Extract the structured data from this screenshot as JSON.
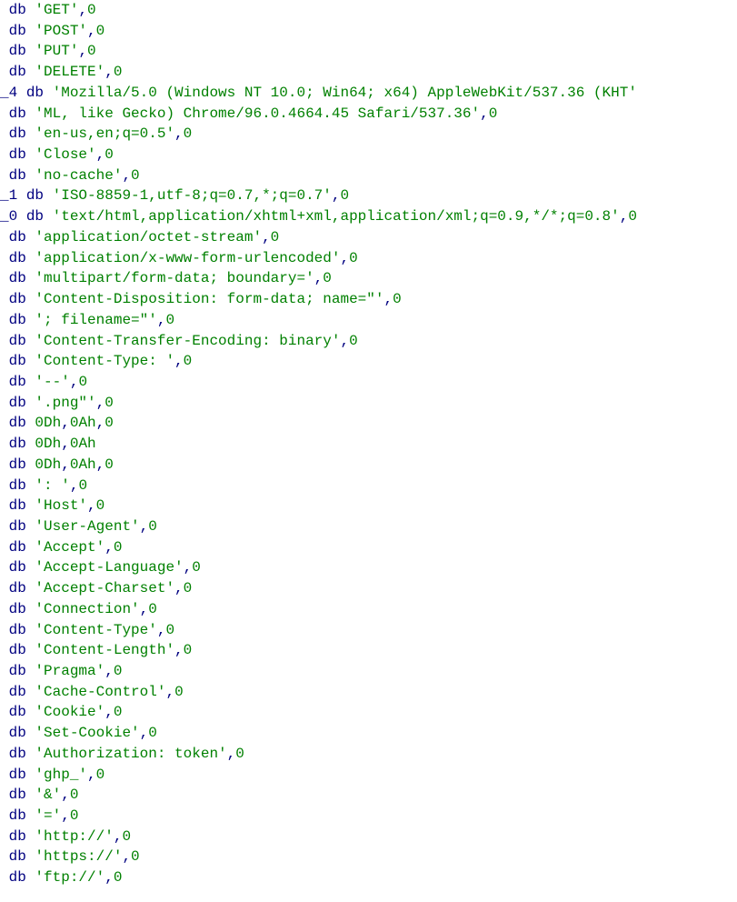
{
  "lines": [
    {
      "label": "",
      "opcode": "db",
      "string": "'GET'",
      "suffix": ",0"
    },
    {
      "label": "",
      "opcode": "db",
      "string": "'POST'",
      "suffix": ",0"
    },
    {
      "label": "",
      "opcode": "db",
      "string": "'PUT'",
      "suffix": ",0"
    },
    {
      "label": "",
      "opcode": "db",
      "string": "'DELETE'",
      "suffix": ",0"
    },
    {
      "label": "_4",
      "opcode": "db",
      "string": "'Mozilla/5.0 (Windows NT 10.0; Win64; x64) AppleWebKit/537.36 (KHT'",
      "suffix": ""
    },
    {
      "label": "",
      "opcode": "db",
      "string": "'ML, like Gecko) Chrome/96.0.4664.45 Safari/537.36'",
      "suffix": ",0"
    },
    {
      "label": "",
      "opcode": "db",
      "string": "'en-us,en;q=0.5'",
      "suffix": ",0"
    },
    {
      "label": "",
      "opcode": "db",
      "string": "'Close'",
      "suffix": ",0"
    },
    {
      "label": "",
      "opcode": "db",
      "string": "'no-cache'",
      "suffix": ",0"
    },
    {
      "label": "_1",
      "opcode": "db",
      "string": "'ISO-8859-1,utf-8;q=0.7,*;q=0.7'",
      "suffix": ",0"
    },
    {
      "label": "_0",
      "opcode": "db",
      "string": "'text/html,application/xhtml+xml,application/xml;q=0.9,*/*;q=0.8'",
      "suffix": ",0"
    },
    {
      "label": "",
      "opcode": "db",
      "string": "'application/octet-stream'",
      "suffix": ",0"
    },
    {
      "label": "",
      "opcode": "db",
      "string": "'application/x-www-form-urlencoded'",
      "suffix": ",0"
    },
    {
      "label": "",
      "opcode": "db",
      "string": "'multipart/form-data; boundary='",
      "suffix": ",0"
    },
    {
      "label": "",
      "opcode": "db",
      "string": "'Content-Disposition: form-data; name=\"'",
      "suffix": ",0"
    },
    {
      "label": "",
      "opcode": "db",
      "string": "'; filename=\"'",
      "suffix": ",0"
    },
    {
      "label": "",
      "opcode": "db",
      "string": "'Content-Transfer-Encoding: binary'",
      "suffix": ",0"
    },
    {
      "label": "",
      "opcode": "db",
      "string": "'Content-Type: '",
      "suffix": ",0"
    },
    {
      "label": "",
      "opcode": "db",
      "string": "'--'",
      "suffix": ",0"
    },
    {
      "label": "",
      "opcode": "db",
      "string": "'.png\"'",
      "suffix": ",0"
    },
    {
      "label": "",
      "opcode": "db",
      "string": "0Dh,0Ah,0",
      "suffix": "",
      "rawbytes": true
    },
    {
      "label": "",
      "opcode": "db",
      "string": "0Dh,0Ah",
      "suffix": "",
      "rawbytes": true
    },
    {
      "label": "",
      "opcode": "db",
      "string": "0Dh,0Ah,0",
      "suffix": "",
      "rawbytes": true
    },
    {
      "label": "",
      "opcode": "db",
      "string": "': '",
      "suffix": ",0"
    },
    {
      "label": "",
      "opcode": "db",
      "string": "'Host'",
      "suffix": ",0"
    },
    {
      "label": "",
      "opcode": "db",
      "string": "'User-Agent'",
      "suffix": ",0"
    },
    {
      "label": "",
      "opcode": "db",
      "string": "'Accept'",
      "suffix": ",0"
    },
    {
      "label": "",
      "opcode": "db",
      "string": "'Accept-Language'",
      "suffix": ",0"
    },
    {
      "label": "",
      "opcode": "db",
      "string": "'Accept-Charset'",
      "suffix": ",0"
    },
    {
      "label": "",
      "opcode": "db",
      "string": "'Connection'",
      "suffix": ",0"
    },
    {
      "label": "",
      "opcode": "db",
      "string": "'Content-Type'",
      "suffix": ",0"
    },
    {
      "label": "",
      "opcode": "db",
      "string": "'Content-Length'",
      "suffix": ",0"
    },
    {
      "label": "",
      "opcode": "db",
      "string": "'Pragma'",
      "suffix": ",0"
    },
    {
      "label": "",
      "opcode": "db",
      "string": "'Cache-Control'",
      "suffix": ",0"
    },
    {
      "label": "",
      "opcode": "db",
      "string": "'Cookie'",
      "suffix": ",0"
    },
    {
      "label": "",
      "opcode": "db",
      "string": "'Set-Cookie'",
      "suffix": ",0"
    },
    {
      "label": "",
      "opcode": "db",
      "string": "'Authorization: token'",
      "suffix": ",0"
    },
    {
      "label": "",
      "opcode": "db",
      "string": "'ghp_'",
      "suffix": ",0"
    },
    {
      "label": "",
      "opcode": "db",
      "string": "'&'",
      "suffix": ",0"
    },
    {
      "label": "",
      "opcode": "db",
      "string": "'='",
      "suffix": ",0"
    },
    {
      "label": "",
      "opcode": "db",
      "string": "'http://'",
      "suffix": ",0"
    },
    {
      "label": "",
      "opcode": "db",
      "string": "'https://'",
      "suffix": ",0"
    },
    {
      "label": "",
      "opcode": "db",
      "string": "'ftp://'",
      "suffix": ",0"
    }
  ]
}
